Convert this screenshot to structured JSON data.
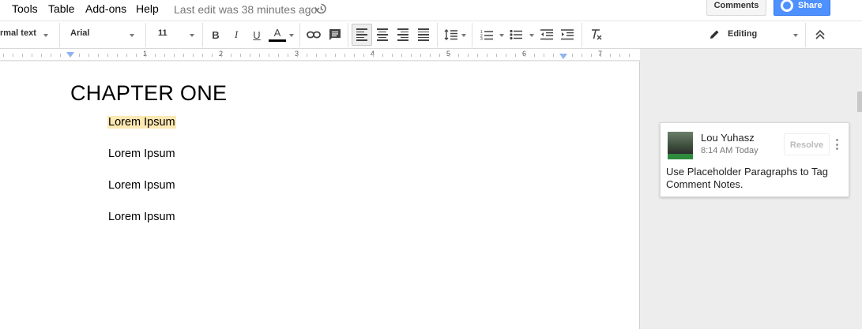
{
  "menu": {
    "items": [
      "Tools",
      "Table",
      "Add-ons",
      "Help"
    ],
    "last_edit": "Last edit was 38 minutes ago"
  },
  "header": {
    "comments_label": "Comments",
    "share_label": "Share"
  },
  "toolbar": {
    "style_value": "rmal text",
    "font_value": "Arial",
    "size_value": "11",
    "mode_value": "Editing",
    "text_color": "#000000"
  },
  "ruler": {
    "numbers": [
      "1",
      "2",
      "3",
      "4",
      "5",
      "6",
      "7"
    ]
  },
  "document": {
    "heading": "CHAPTER ONE",
    "paragraphs": [
      "Lorem Ipsum",
      "Lorem Ipsum",
      "Lorem Ipsum",
      "Lorem Ipsum"
    ]
  },
  "comment": {
    "author": "Lou Yuhasz",
    "time": "8:14 AM Today",
    "resolve_label": "Resolve",
    "text": "Use Placeholder Paragraphs to Tag Comment Notes."
  },
  "colors": {
    "accent": "#4d90fe",
    "highlight": "#fce8b2"
  }
}
